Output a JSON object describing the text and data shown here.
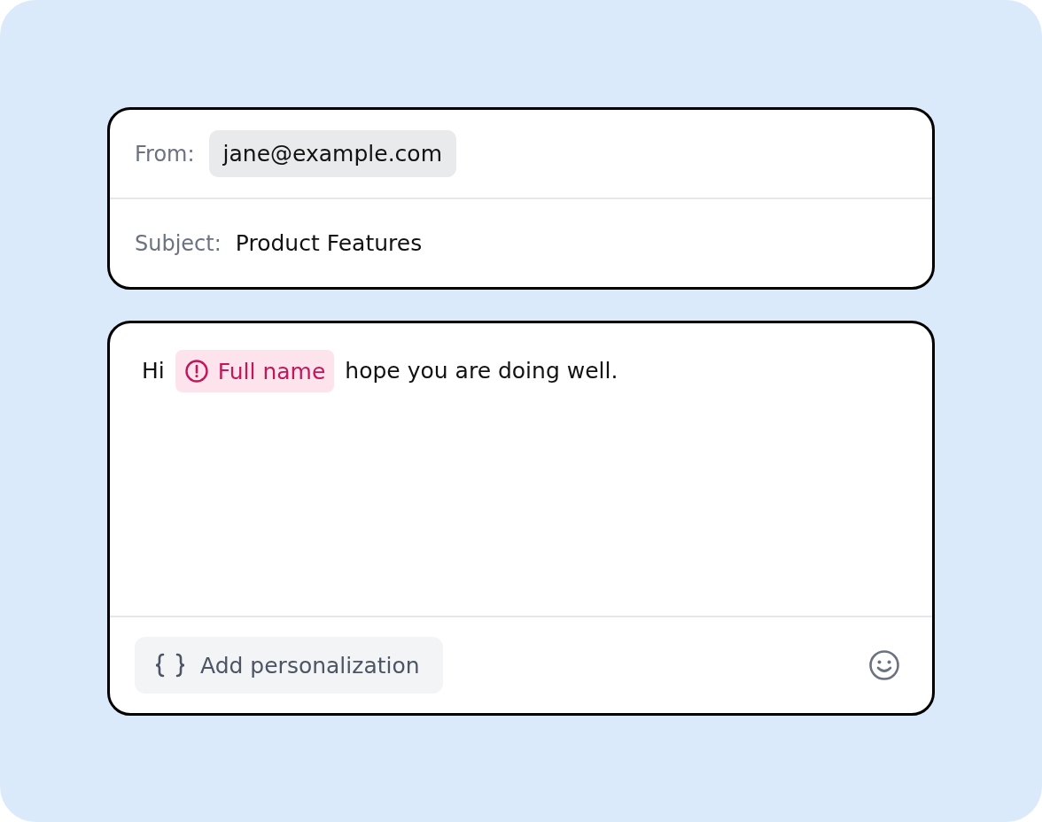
{
  "header": {
    "from": {
      "label": "From:",
      "value": "jane@example.com"
    },
    "subject": {
      "label": "Subject:",
      "value": "Product Features"
    }
  },
  "body": {
    "segments": [
      {
        "kind": "text",
        "text": "Hi"
      },
      {
        "kind": "variable",
        "text": "Full name",
        "error": true
      },
      {
        "kind": "text",
        "text": "hope you are doing well."
      }
    ]
  },
  "toolbar": {
    "button": "Add personalization"
  }
}
